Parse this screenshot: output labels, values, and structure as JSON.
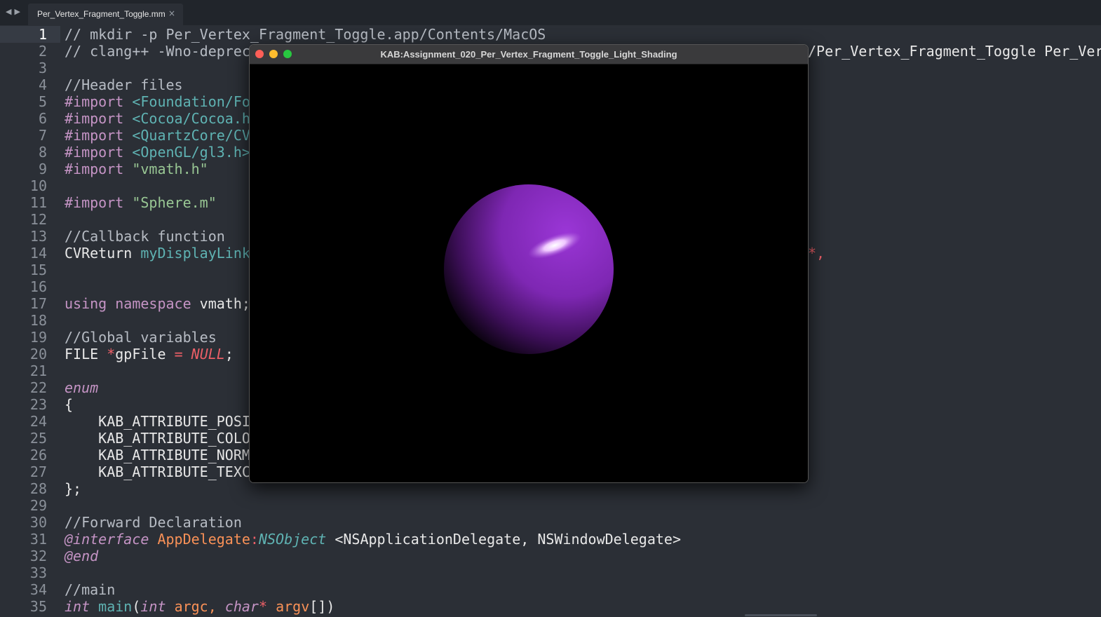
{
  "tabbar": {
    "back_glyph": "◀",
    "forward_glyph": "▶",
    "active_tab": "Per_Vertex_Fragment_Toggle.mm",
    "close_glyph": "×"
  },
  "editor": {
    "right_overflow_line2": "/Per_Vertex_Fragment_Toggle Per_Ver",
    "right_overflow_line14": "*,",
    "lines": [
      {
        "n": "1",
        "text": "// mkdir -p Per_Vertex_Fragment_Toggle.app/Contents/MacOS"
      },
      {
        "n": "2",
        "text": "// clang++ -Wno-deprec"
      },
      {
        "n": "3",
        "text": ""
      },
      {
        "n": "4",
        "text": "//Header files"
      },
      {
        "n": "5",
        "kw": "#import ",
        "rest": "<Foundation/Fo"
      },
      {
        "n": "6",
        "kw": "#import ",
        "rest": "<Cocoa/Cocoa.h"
      },
      {
        "n": "7",
        "kw": "#import ",
        "rest": "<QuartzCore/CV"
      },
      {
        "n": "8",
        "kw": "#import ",
        "rest": "<OpenGL/gl3.h>"
      },
      {
        "n": "9",
        "kw": "#import ",
        "rest": "\"vmath.h\""
      },
      {
        "n": "10",
        "text": ""
      },
      {
        "n": "11",
        "kw": "#import ",
        "rest": "\"Sphere.m\""
      },
      {
        "n": "12",
        "text": ""
      },
      {
        "n": "13",
        "text": "//Callback function"
      },
      {
        "n": "14",
        "a": "CVReturn ",
        "b": "myDisplayLink"
      },
      {
        "n": "15",
        "text": ""
      },
      {
        "n": "16",
        "text": ""
      },
      {
        "n": "17",
        "a": "using namespace ",
        "b": "vmath;"
      },
      {
        "n": "18",
        "text": ""
      },
      {
        "n": "19",
        "text": "//Global variables"
      },
      {
        "n": "20",
        "a": "FILE ",
        "b": "*",
        "c": "gpFile ",
        "d": "= ",
        "e": "NULL",
        "f": ";"
      },
      {
        "n": "21",
        "text": ""
      },
      {
        "n": "22",
        "text": "enum"
      },
      {
        "n": "23",
        "text": "{"
      },
      {
        "n": "24",
        "text": "    KAB_ATTRIBUTE_POSI"
      },
      {
        "n": "25",
        "text": "    KAB_ATTRIBUTE_COLO"
      },
      {
        "n": "26",
        "text": "    KAB_ATTRIBUTE_NORM"
      },
      {
        "n": "27",
        "text": "    KAB_ATTRIBUTE_TEXC"
      },
      {
        "n": "28",
        "text": "};"
      },
      {
        "n": "29",
        "text": ""
      },
      {
        "n": "30",
        "text": "//Forward Declaration"
      },
      {
        "n": "31",
        "a": "@interface ",
        "b": "AppDelegate",
        "c": ":",
        "d": "NSObject ",
        "e": "<NSApplicationDelegate, NSWindowDelegate>"
      },
      {
        "n": "32",
        "text": "@end"
      },
      {
        "n": "33",
        "text": ""
      },
      {
        "n": "34",
        "text": "//main"
      },
      {
        "n": "35",
        "a": "int ",
        "b": "main",
        "c": "(",
        "d": "int ",
        "e": "argc, ",
        "f": "char",
        "g": "* ",
        "h": "argv",
        "i": "[])"
      }
    ]
  },
  "gl_window": {
    "title": "KAB:Assignment_020_Per_Vertex_Fragment_Toggle_Light_Shading",
    "sphere_color": "#8a2fc0",
    "highlight_color": "#f0c8ff",
    "background": "#000000"
  }
}
